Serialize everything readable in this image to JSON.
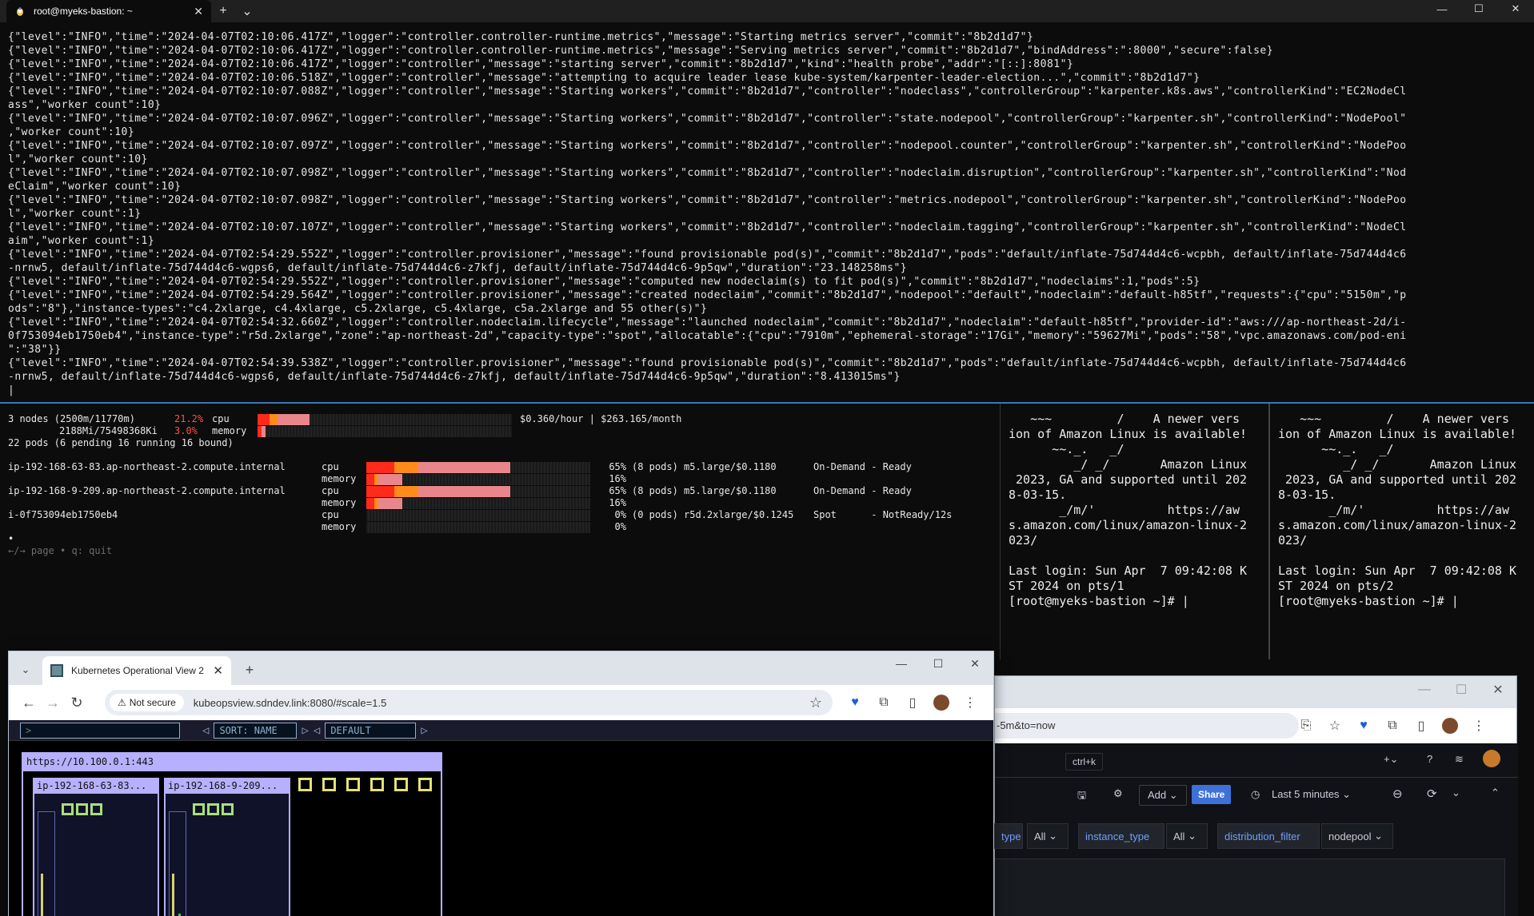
{
  "terminal": {
    "tab_title": "root@myeks-bastion: ~",
    "new_tab": "+",
    "dropdown": "⌄",
    "window_controls": [
      "—",
      "☐",
      "✕"
    ],
    "log_lines": [
      "{\"level\":\"INFO\",\"time\":\"2024-04-07T02:10:06.417Z\",\"logger\":\"controller.controller-runtime.metrics\",\"message\":\"Starting metrics server\",\"commit\":\"8b2d1d7\"}",
      "{\"level\":\"INFO\",\"time\":\"2024-04-07T02:10:06.417Z\",\"logger\":\"controller.controller-runtime.metrics\",\"message\":\"Serving metrics server\",\"commit\":\"8b2d1d7\",\"bindAddress\":\":8000\",\"secure\":false}",
      "{\"level\":\"INFO\",\"time\":\"2024-04-07T02:10:06.417Z\",\"logger\":\"controller\",\"message\":\"starting server\",\"commit\":\"8b2d1d7\",\"kind\":\"health probe\",\"addr\":\"[::]:8081\"}",
      "{\"level\":\"INFO\",\"time\":\"2024-04-07T02:10:06.518Z\",\"logger\":\"controller\",\"message\":\"attempting to acquire leader lease kube-system/karpenter-leader-election...\",\"commit\":\"8b2d1d7\"}",
      "{\"level\":\"INFO\",\"time\":\"2024-04-07T02:10:07.088Z\",\"logger\":\"controller\",\"message\":\"Starting workers\",\"commit\":\"8b2d1d7\",\"controller\":\"nodeclass\",\"controllerGroup\":\"karpenter.k8s.aws\",\"controllerKind\":\"EC2NodeCl",
      "ass\",\"worker count\":10}",
      "{\"level\":\"INFO\",\"time\":\"2024-04-07T02:10:07.096Z\",\"logger\":\"controller\",\"message\":\"Starting workers\",\"commit\":\"8b2d1d7\",\"controller\":\"state.nodepool\",\"controllerGroup\":\"karpenter.sh\",\"controllerKind\":\"NodePool\"",
      ",\"worker count\":10}",
      "{\"level\":\"INFO\",\"time\":\"2024-04-07T02:10:07.097Z\",\"logger\":\"controller\",\"message\":\"Starting workers\",\"commit\":\"8b2d1d7\",\"controller\":\"nodepool.counter\",\"controllerGroup\":\"karpenter.sh\",\"controllerKind\":\"NodePoo",
      "l\",\"worker count\":10}",
      "{\"level\":\"INFO\",\"time\":\"2024-04-07T02:10:07.098Z\",\"logger\":\"controller\",\"message\":\"Starting workers\",\"commit\":\"8b2d1d7\",\"controller\":\"nodeclaim.disruption\",\"controllerGroup\":\"karpenter.sh\",\"controllerKind\":\"Nod",
      "eClaim\",\"worker count\":10}",
      "{\"level\":\"INFO\",\"time\":\"2024-04-07T02:10:07.098Z\",\"logger\":\"controller\",\"message\":\"Starting workers\",\"commit\":\"8b2d1d7\",\"controller\":\"metrics.nodepool\",\"controllerGroup\":\"karpenter.sh\",\"controllerKind\":\"NodePoo",
      "l\",\"worker count\":1}",
      "{\"level\":\"INFO\",\"time\":\"2024-04-07T02:10:07.107Z\",\"logger\":\"controller\",\"message\":\"Starting workers\",\"commit\":\"8b2d1d7\",\"controller\":\"nodeclaim.tagging\",\"controllerGroup\":\"karpenter.sh\",\"controllerKind\":\"NodeCl",
      "aim\",\"worker count\":1}",
      "{\"level\":\"INFO\",\"time\":\"2024-04-07T02:54:29.552Z\",\"logger\":\"controller.provisioner\",\"message\":\"found provisionable pod(s)\",\"commit\":\"8b2d1d7\",\"pods\":\"default/inflate-75d744d4c6-wcpbh, default/inflate-75d744d4c6",
      "-nrnw5, default/inflate-75d744d4c6-wgps6, default/inflate-75d744d4c6-z7kfj, default/inflate-75d744d4c6-9p5qw\",\"duration\":\"23.148258ms\"}",
      "{\"level\":\"INFO\",\"time\":\"2024-04-07T02:54:29.552Z\",\"logger\":\"controller.provisioner\",\"message\":\"computed new nodeclaim(s) to fit pod(s)\",\"commit\":\"8b2d1d7\",\"nodeclaims\":1,\"pods\":5}",
      "{\"level\":\"INFO\",\"time\":\"2024-04-07T02:54:29.564Z\",\"logger\":\"controller.provisioner\",\"message\":\"created nodeclaim\",\"commit\":\"8b2d1d7\",\"nodepool\":\"default\",\"nodeclaim\":\"default-h85tf\",\"requests\":{\"cpu\":\"5150m\",\"p",
      "ods\":\"8\"},\"instance-types\":\"c4.2xlarge, c4.4xlarge, c5.2xlarge, c5.4xlarge, c5a.2xlarge and 55 other(s)\"}",
      "{\"level\":\"INFO\",\"time\":\"2024-04-07T02:54:32.660Z\",\"logger\":\"controller.nodeclaim.lifecycle\",\"message\":\"launched nodeclaim\",\"commit\":\"8b2d1d7\",\"nodeclaim\":\"default-h85tf\",\"provider-id\":\"aws:///ap-northeast-2d/i-",
      "0f753094eb1750eb4\",\"instance-type\":\"r5d.2xlarge\",\"zone\":\"ap-northeast-2d\",\"capacity-type\":\"spot\",\"allocatable\":{\"cpu\":\"7910m\",\"ephemeral-storage\":\"17Gi\",\"memory\":\"59627Mi\",\"pods\":\"58\",\"vpc.amazonaws.com/pod-eni",
      "\":\"38\"}}",
      "{\"level\":\"INFO\",\"time\":\"2024-04-07T02:54:39.538Z\",\"logger\":\"controller.provisioner\",\"message\":\"found provisionable pod(s)\",\"commit\":\"8b2d1d7\",\"pods\":\"default/inflate-75d744d4c6-wcpbh, default/inflate-75d744d4c6",
      "-nrnw5, default/inflate-75d744d4c6-wgps6, default/inflate-75d744d4c6-z7kfj, default/inflate-75d744d4c6-9p5qw\",\"duration\":\"8.413015ms\"}",
      "|"
    ]
  },
  "node_viewer": {
    "summary_nodes": "3 nodes (2500m/11770m)",
    "summary_cpu_pct": "21.2%",
    "summary_cpu_label": "cpu",
    "summary_mem": "2188Mi/75498368Ki",
    "summary_mem_pct": "3.0%",
    "summary_mem_label": "memory",
    "price": "$0.360/hour | $263.165/month",
    "pods_line": "22 pods (6 pending 16 running 16 bound)",
    "cluster_cpu_fraction": 0.212,
    "cluster_mem_fraction": 0.03,
    "nodes": [
      {
        "name": "ip-192-168-63-83.ap-northeast-2.compute.internal",
        "cpu_label": "cpu",
        "mem_label": "memory",
        "cpu_pct": "65%",
        "detail": "(8 pods) m5.large/$0.1180",
        "status": "On-Demand - Ready",
        "mem_pct": "16%",
        "cpu_fraction": 0.65,
        "mem_fraction": 0.16
      },
      {
        "name": "ip-192-168-9-209.ap-northeast-2.compute.internal",
        "cpu_label": "cpu",
        "mem_label": "memory",
        "cpu_pct": "65%",
        "detail": "(8 pods) m5.large/$0.1180",
        "status": "On-Demand - Ready",
        "mem_pct": "16%",
        "cpu_fraction": 0.65,
        "mem_fraction": 0.16
      },
      {
        "name": "i-0f753094eb1750eb4",
        "cpu_label": "cpu",
        "mem_label": "memory",
        "cpu_pct": "0%",
        "detail": "(0 pods) r5d.2xlarge/$0.1245",
        "status": "Spot      - NotReady/12s",
        "mem_pct": "0%",
        "cpu_fraction": 0,
        "mem_fraction": 0
      }
    ],
    "dot": "•",
    "help": "←/→ page • q: quit",
    "colors": {
      "bar_red": "#ff2a1a",
      "bar_orange": "#ff8c1a",
      "bar_pink": "#e8868c",
      "pct_red": "#ff4d4d"
    }
  },
  "side_terminal_1": {
    "text": "   ~~~         /    A newer vers\nion of Amazon Linux is available!\n      ~~._.   _/\n         _/ _/       Amazon Linux\n 2023, GA and supported until 202\n8-03-15.\n       _/m/'          https://aw\ns.amazon.com/linux/amazon-linux-2\n023/\n\nLast login: Sun Apr  7 09:42:08 K\nST 2024 on pts/1\n[root@myeks-bastion ~]# |"
  },
  "side_terminal_2": {
    "text": "   ~~~         /    A newer vers\nion of Amazon Linux is available!\n      ~~._.   _/\n         _/ _/       Amazon Linux\n 2023, GA and supported until 202\n8-03-15.\n       _/m/'          https://aw\ns.amazon.com/linux/amazon-linux-2\n023/\n\nLast login: Sun Apr  7 09:42:08 K\nST 2024 on pts/2\n[root@myeks-bastion ~]# |"
  },
  "browser1": {
    "tab_title": "Kubernetes Operational View 2",
    "tab_close": "✕",
    "new_tab": "+",
    "window_controls": [
      "—",
      "☐",
      "✕"
    ],
    "not_secure": "Not secure",
    "url": "kubeopsview.sdndev.link:8080/#scale=1.5",
    "kov": {
      "filter_placeholder": ">",
      "sort_label": "SORT: NAME",
      "namespace_label": "DEFAULT",
      "cluster_url": "https://10.100.0.1:443",
      "nodes": [
        "ip-192-168-63-83...",
        "ip-192-168-9-209..."
      ],
      "pending_pods": 6
    }
  },
  "browser2": {
    "window_controls": [
      "—",
      "☐",
      "✕"
    ],
    "url_fragment": "-5m&to=now",
    "search_hint": "ctrl+k",
    "add_label": "Add",
    "share_label": "Share",
    "time_range": "Last 5 minutes",
    "vars": [
      {
        "label": "type",
        "value": "All"
      },
      {
        "label": "instance_type",
        "value": "All"
      },
      {
        "label": "distribution_filter",
        "value": "nodepool"
      }
    ]
  }
}
